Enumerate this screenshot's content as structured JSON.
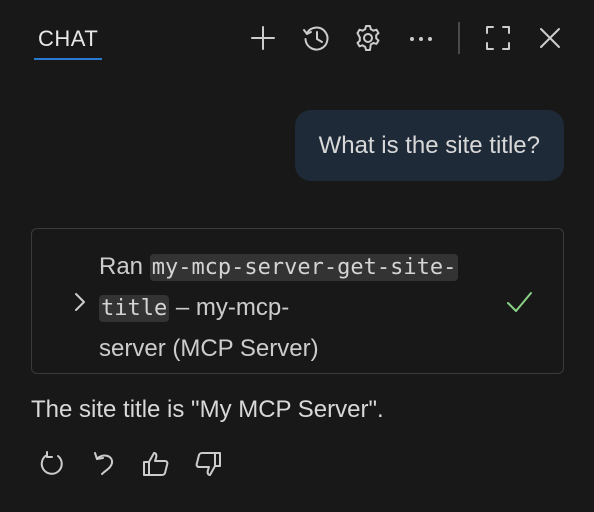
{
  "header": {
    "tab_label": "CHAT",
    "icons": [
      "plus-icon",
      "history-icon",
      "gear-icon",
      "more-icon",
      "maximize-icon",
      "close-icon"
    ]
  },
  "conversation": {
    "user_message": "What is the site title?",
    "tool_run": {
      "prefix": "Ran",
      "tool_name_part1": "my-mcp-server-get-site-",
      "tool_name_part2": "title",
      "suffix_line2": " – my-mcp-",
      "suffix_line3": "server (MCP Server)",
      "status": "success"
    },
    "response": "The site title is \"My MCP Server\"."
  },
  "actions": [
    "retry-icon",
    "undo-icon",
    "thumbs-up-icon",
    "thumbs-down-icon"
  ],
  "colors": {
    "background": "#181818",
    "accent": "#2b79d0",
    "user_bubble": "#1e2a38",
    "success": "#89d185"
  }
}
